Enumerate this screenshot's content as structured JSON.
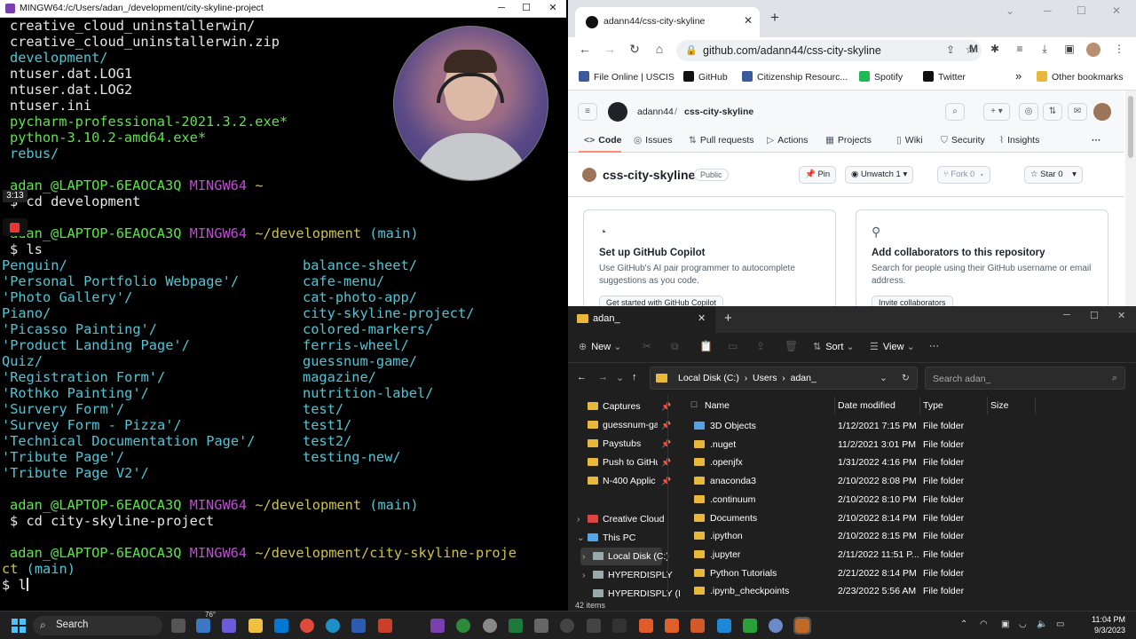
{
  "terminal": {
    "title": "MINGW64:/c/Users/adan_/development/city-skyline-project",
    "recording_time": "3:13",
    "lines": [
      {
        "cls": "wht",
        "text": "creative_cloud_uninstallerwin/"
      },
      {
        "cls": "wht",
        "text": "creative_cloud_uninstallerwin.zip"
      },
      {
        "cls": "cya",
        "text": "development/"
      },
      {
        "cls": "wht",
        "text": "ntuser.dat.LOG1"
      },
      {
        "cls": "wht",
        "text": "ntuser.dat.LOG2"
      },
      {
        "cls": "wht",
        "text": "ntuser.ini"
      },
      {
        "cls": "grn",
        "text": "pycharm-professional-2021.3.2.exe*"
      },
      {
        "cls": "grn",
        "text": "python-3.10.2-amd64.exe*"
      },
      {
        "cls": "cya",
        "text": "rebus/"
      }
    ],
    "prompt_user": "adan_@LAPTOP-6EAOCA3Q",
    "prompt_shell": "MINGW64",
    "prompt_home": "~",
    "cmd_cd_dev": "cd development",
    "prompt_dev": "~/development",
    "branch": "(main)",
    "cmd_ls": "ls",
    "ls_left": [
      "Penguin/",
      "'Personal Portfolio Webpage'/",
      "'Photo Gallery'/",
      "Piano/",
      "'Picasso Painting'/",
      "'Product Landing Page'/",
      "Quiz/",
      "'Registration Form'/",
      "'Rothko Painting'/",
      "'Survery Form'/",
      "'Survey Form - Pizza'/",
      "'Technical Documentation Page'/",
      "'Tribute Page'/",
      "'Tribute Page V2'/"
    ],
    "ls_right": [
      "balance-sheet/",
      "cafe-menu/",
      "cat-photo-app/",
      "city-skyline-project/",
      "colored-markers/",
      "ferris-wheel/",
      "guessnum-game/",
      "magazine/",
      "nutrition-label/",
      "test/",
      "test1/",
      "test2/",
      "testing-new/"
    ],
    "cmd_cd_project": "cd city-skyline-project",
    "prompt_project_a": "~/development/city-skyline-proje",
    "prompt_project_b": "ct",
    "dollar": "$",
    "current_input": "l"
  },
  "browser": {
    "tab_title": "adann44/css-city-skyline",
    "url": "github.com/adann44/css-city-skyline",
    "bookmarks": [
      {
        "label": "File Online | USCIS",
        "color": "#3a5a9a"
      },
      {
        "label": "GitHub",
        "color": "#111111"
      },
      {
        "label": "Citizenship Resourc...",
        "color": "#3a5a9a"
      },
      {
        "label": "Spotify",
        "color": "#1db954"
      },
      {
        "label": "Twitter",
        "color": "#111111"
      }
    ],
    "bookmarks_more": "»",
    "other_bookmarks": "Other bookmarks",
    "repo_owner": "adann44",
    "repo_sep": "/",
    "repo_name": "css-city-skyline",
    "nav": [
      {
        "label": "Code",
        "icon": "<>"
      },
      {
        "label": "Issues",
        "icon": "◎"
      },
      {
        "label": "Pull requests",
        "icon": "⇅"
      },
      {
        "label": "Actions",
        "icon": "▷"
      },
      {
        "label": "Projects",
        "icon": "▦"
      },
      {
        "label": "Wiki",
        "icon": "▯"
      },
      {
        "label": "Security",
        "icon": "⛉"
      },
      {
        "label": "Insights",
        "icon": "⌇"
      }
    ],
    "nav_more": "···",
    "repo_title": "css-city-skyline",
    "visibility": "Public",
    "pin_label": "Pin",
    "unwatch_label": "Unwatch",
    "unwatch_count": "1",
    "fork_label": "Fork",
    "fork_count": "0",
    "star_label": "Star",
    "star_count": "0",
    "cards": [
      {
        "title": "Set up GitHub Copilot",
        "desc": "Use GitHub's AI pair programmer to autocomplete suggestions as you code.",
        "button": "Get started with GitHub Copilot"
      },
      {
        "title": "Add collaborators to this repository",
        "desc": "Search for people using their GitHub username or email address.",
        "button": "Invite collaborators"
      }
    ]
  },
  "explorer": {
    "tab_title": "adan_",
    "new_label": "New",
    "sort_label": "Sort",
    "view_label": "View",
    "more_label": "···",
    "breadcrumb": [
      "Local Disk (C:)",
      "Users",
      "adan_"
    ],
    "search_placeholder": "Search adan_",
    "nav_items": [
      {
        "label": "Captures",
        "pinned": true
      },
      {
        "label": "guessnum-ga",
        "pinned": true
      },
      {
        "label": "Paystubs",
        "pinned": true
      },
      {
        "label": "Push to GitHu",
        "pinned": true
      },
      {
        "label": "N-400 Applic",
        "pinned": true
      }
    ],
    "nav_tree": [
      "Creative Cloud",
      "This PC",
      "Local Disk (C:)",
      "HYPERDISPLY",
      "HYPERDISPLY (I"
    ],
    "columns": [
      "Name",
      "Date modified",
      "Type",
      "Size"
    ],
    "rows": [
      {
        "name": "3D Objects",
        "date": "1/12/2021 7:15 PM",
        "type": "File folder"
      },
      {
        "name": ".nuget",
        "date": "11/2/2021 3:01 PM",
        "type": "File folder"
      },
      {
        "name": ".openjfx",
        "date": "1/31/2022 4:16 PM",
        "type": "File folder"
      },
      {
        "name": "anaconda3",
        "date": "2/10/2022 8:08 PM",
        "type": "File folder"
      },
      {
        "name": ".continuum",
        "date": "2/10/2022 8:10 PM",
        "type": "File folder"
      },
      {
        "name": "Documents",
        "date": "2/10/2022 8:14 PM",
        "type": "File folder"
      },
      {
        "name": ".ipython",
        "date": "2/10/2022 8:15 PM",
        "type": "File folder"
      },
      {
        "name": ".jupyter",
        "date": "2/11/2022 11:51 P...",
        "type": "File folder"
      },
      {
        "name": "Python Tutorials",
        "date": "2/21/2022 8:14 PM",
        "type": "File folder"
      },
      {
        "name": ".ipynb_checkpoints",
        "date": "2/23/2022 5:56 AM",
        "type": "File folder"
      }
    ],
    "status": "42 items"
  },
  "taskbar": {
    "search_label": "Search",
    "weather": "76°",
    "time": "11:04 PM",
    "date": "9/3/2023"
  }
}
